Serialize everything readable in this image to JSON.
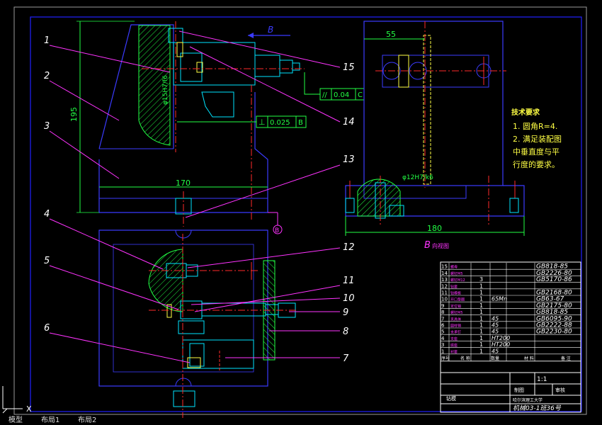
{
  "balloons": [
    "1",
    "2",
    "3",
    "4",
    "5",
    "6",
    "7",
    "8",
    "9",
    "10",
    "11",
    "12",
    "13",
    "14",
    "15"
  ],
  "dims": {
    "height_195": "195",
    "width_170": "170",
    "dim_55": "55",
    "width_180": "180",
    "fit_left": "φ15H7/f6",
    "fit_right": "φ12H7/k6"
  },
  "tolerances": {
    "parallel_sym": "//",
    "parallel_val": "0.04",
    "parallel_ref": "C",
    "perp_sym": "⊥",
    "perp_val": "0.025",
    "perp_ref": "B"
  },
  "view_labels": {
    "arrow_b": "B",
    "datum_b": "B",
    "view_b": "B",
    "view_b_suffix": "向视图"
  },
  "tech_req": {
    "title": "技术要求",
    "lines": [
      "1. 圆角R=4.",
      "2. 满足装配图",
      "中垂直度与平",
      "行度的要求。"
    ]
  },
  "bom": {
    "rows": [
      {
        "no": "15",
        "name": "螺母",
        "qty": "",
        "mat": "",
        "std": "GB818-85"
      },
      {
        "no": "14",
        "name": "螺钉M5",
        "qty": "",
        "mat": "",
        "std": "GB2226-80"
      },
      {
        "no": "13",
        "name": "螺钉M12",
        "qty": "3",
        "mat": "",
        "std": "GB5170-86"
      },
      {
        "no": "12",
        "name": "钻套",
        "qty": "1",
        "mat": "",
        "std": ""
      },
      {
        "no": "11",
        "name": "钻模板",
        "qty": "1",
        "mat": "",
        "std": "GB2168-80"
      },
      {
        "no": "10",
        "name": "开口垫圈",
        "qty": "1",
        "mat": "65Mn",
        "std": "GB63-67"
      },
      {
        "no": "9",
        "name": "定位销",
        "qty": "1",
        "mat": "",
        "std": "GB2175-80"
      },
      {
        "no": "8",
        "name": "螺钉M5",
        "qty": "1",
        "mat": "",
        "std": "GB818-85"
      },
      {
        "no": "7",
        "name": "夹具体",
        "qty": "1",
        "mat": "45",
        "std": "GB6095-90"
      },
      {
        "no": "6",
        "name": "圆柱销",
        "qty": "1",
        "mat": "45",
        "std": "GB2222-88"
      },
      {
        "no": "5",
        "name": "支承钉",
        "qty": "1",
        "mat": "45",
        "std": "GB2230-80"
      },
      {
        "no": "4",
        "name": "支座",
        "qty": "1",
        "mat": "HT200",
        "std": ""
      },
      {
        "no": "3",
        "name": "底座",
        "qty": "1",
        "mat": "HT200",
        "std": ""
      },
      {
        "no": "1",
        "name": "衬套",
        "qty": "1",
        "mat": "45",
        "std": ""
      }
    ],
    "header": [
      "序号",
      "名 称",
      "数量",
      "材 料",
      "备 注"
    ],
    "footer": {
      "name": "钻模",
      "scale": "1:1",
      "drawn": "制图",
      "checked": "审核",
      "school": "哈尔滨理工大学",
      "drawing_no": "机械03-1班36号"
    }
  },
  "command_line": {
    "tabs": [
      "模型",
      "布局1",
      "布局2"
    ]
  },
  "colors": {
    "background": "#000000",
    "frame": "#2222ff",
    "part_outline": "#3b3bff",
    "cyan": "#00e5ff",
    "green": "#22ff44",
    "magenta": "#ff33ff",
    "red": "#ff2a2a",
    "yellow": "#ffff44",
    "white": "#ffffff"
  }
}
